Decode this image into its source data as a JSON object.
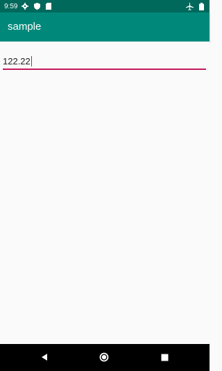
{
  "status_bar": {
    "time": "9:59",
    "icons_left": [
      "gear-icon",
      "shield-icon",
      "sd-card-icon"
    ],
    "icons_right": [
      "airplane-mode-icon",
      "battery-icon"
    ],
    "color": "#00695c"
  },
  "app_bar": {
    "title": "sample",
    "color": "#00897b"
  },
  "input": {
    "value": "122.22",
    "underline_color": "#c2185b"
  },
  "nav_bar": {
    "buttons": [
      "back-icon",
      "home-icon",
      "recents-icon"
    ]
  }
}
